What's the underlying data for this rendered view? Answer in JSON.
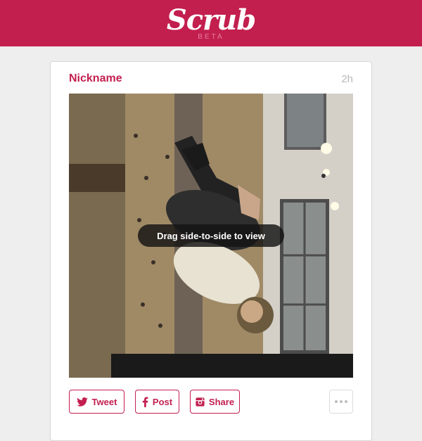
{
  "header": {
    "logo_text": "Scrub",
    "badge": "BETA"
  },
  "post": {
    "nickname": "Nickname",
    "time": "2h",
    "video": {
      "description": "person doing a backflip in front of a climbing wall",
      "overlay_text": "Drag side-to-side to view"
    },
    "actions": {
      "tweet_label": "Tweet",
      "post_label": "Post",
      "share_label": "Share",
      "more_icon": "ellipsis-icon"
    }
  },
  "colors": {
    "brand": "#c21f4f",
    "background": "#eeeeee",
    "card": "#ffffff",
    "muted_text": "#b8b8b8"
  }
}
